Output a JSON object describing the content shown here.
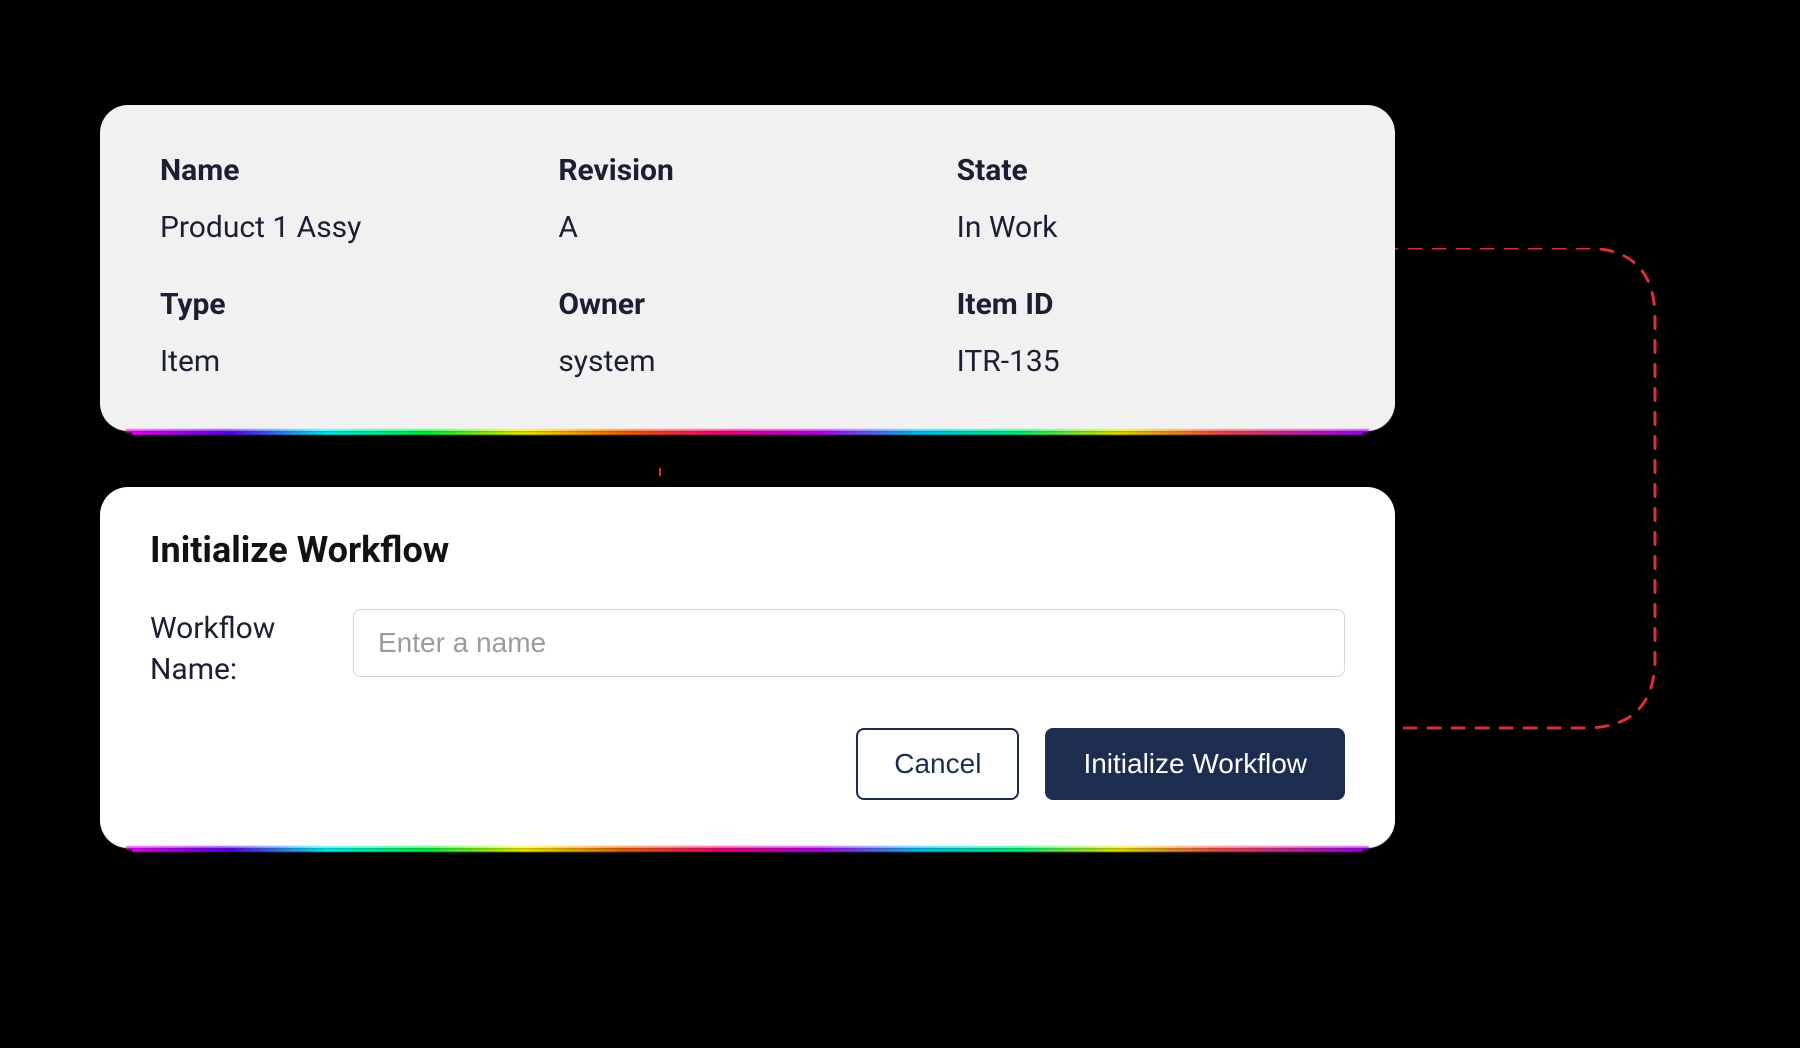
{
  "info": {
    "fields": [
      {
        "label": "Name",
        "value": "Product 1 Assy"
      },
      {
        "label": "Revision",
        "value": "A"
      },
      {
        "label": "State",
        "value": "In Work"
      },
      {
        "label": "Type",
        "value": "Item"
      },
      {
        "label": "Owner",
        "value": "system"
      },
      {
        "label": "Item ID",
        "value": "ITR-135"
      }
    ]
  },
  "modal": {
    "title": "Initialize Workflow",
    "nameLabel": "Workflow Name:",
    "namePlaceholder": "Enter a name",
    "nameValue": "",
    "cancelLabel": "Cancel",
    "submitLabel": "Initialize Workflow"
  }
}
